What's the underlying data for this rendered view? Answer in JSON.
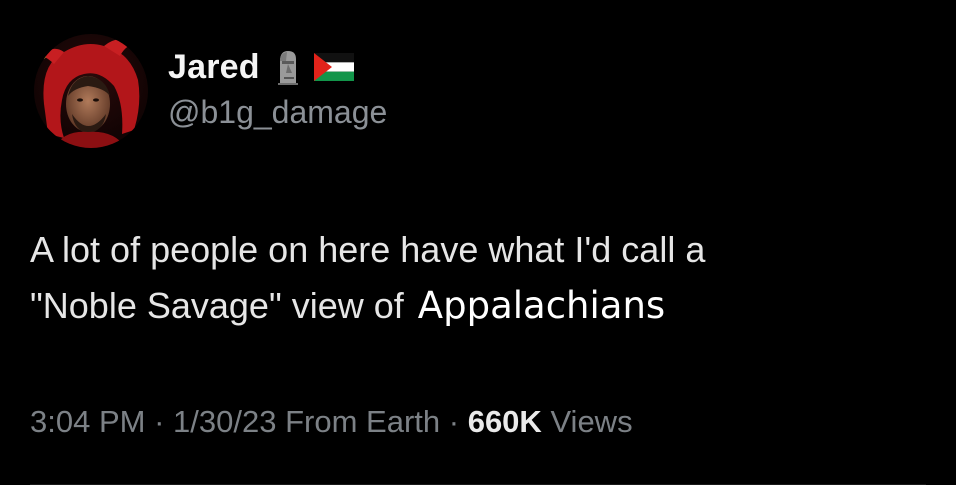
{
  "author": {
    "display_name": "Jared",
    "handle": "@b1g_damage",
    "name_emojis": [
      "moai-icon",
      "palestine-flag-icon"
    ]
  },
  "tweet": {
    "line1": "A lot of people on here have what I'd call a",
    "line2": "\"Noble Savage\" view of",
    "edited_word": "Appalachians"
  },
  "meta": {
    "time": "3:04 PM",
    "sep1": "·",
    "date": "1/30/23",
    "source": "From Earth",
    "sep2": "·",
    "views_count": "660K",
    "views_label": "Views"
  },
  "colors": {
    "background": "#000000",
    "text": "#e6e6e6",
    "secondary": "#7c8186",
    "avatar_red": "#b3161a"
  }
}
